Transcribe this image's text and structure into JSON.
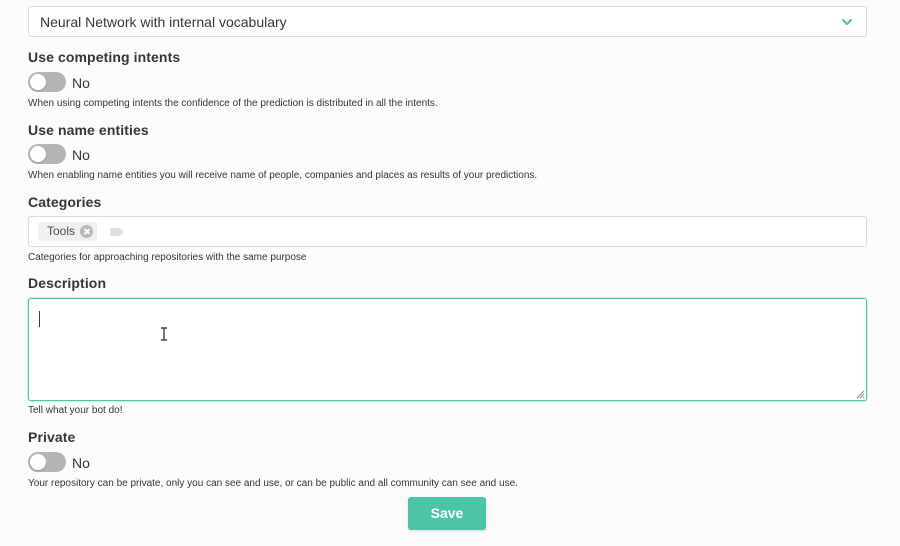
{
  "model_select": {
    "value": "Neural Network with internal vocabulary",
    "chevron_icon": "chevron-down-icon",
    "chevron_color": "#4dc3a7"
  },
  "competing_intents": {
    "label": "Use competing intents",
    "toggle_state": "No",
    "help": "When using competing intents the confidence of the prediction is distributed in all the intents."
  },
  "name_entities": {
    "label": "Use name entities",
    "toggle_state": "No",
    "help": "When enabling name entities you will receive name of people, companies and places as results of your predictions."
  },
  "categories": {
    "label": "Categories",
    "tags": [
      "Tools"
    ],
    "add_icon": "tag-icon",
    "help": "Categories for approaching repositories with the same purpose"
  },
  "description": {
    "label": "Description",
    "value": "",
    "help": "Tell what your bot do!",
    "focus_color": "#4ec5a8"
  },
  "private": {
    "label": "Private",
    "toggle_state": "No",
    "help": "Your repository can be private, only you can see and use, or can be public and all community can see and use."
  },
  "actions": {
    "save_label": "Save",
    "accent_color": "#4dc3a7"
  }
}
